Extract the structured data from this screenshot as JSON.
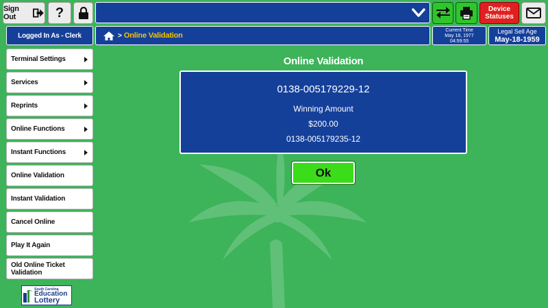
{
  "header": {
    "sign_out_label": "Sign Out",
    "help_label": "?",
    "device_statuses_label": "Device Statuses"
  },
  "status": {
    "logged_in": "Logged In As - Clerk",
    "current_time_label": "Current Time",
    "current_date": "May 18, 1977",
    "current_time": "04:59:55",
    "legal_sell_age_label": "Legal Sell Age",
    "legal_sell_age_date": "May-18-1959"
  },
  "breadcrumb": {
    "separator": ">",
    "current": "Online Validation"
  },
  "sidebar": {
    "items": [
      {
        "label": "Terminal Settings",
        "submenu": true
      },
      {
        "label": "Services",
        "submenu": true
      },
      {
        "label": "Reprints",
        "submenu": true
      },
      {
        "label": "Online Functions",
        "submenu": true
      },
      {
        "label": "Instant Functions",
        "submenu": true
      },
      {
        "label": "Online Validation",
        "submenu": false
      },
      {
        "label": "Instant Validation",
        "submenu": false
      },
      {
        "label": "Cancel Online",
        "submenu": false
      },
      {
        "label": "Play It Again",
        "submenu": false
      },
      {
        "label": "Old Online Ticket Validation",
        "submenu": false
      }
    ]
  },
  "logo": {
    "line1": "South Carolina",
    "line2": "Education",
    "line3": "Lottery"
  },
  "main": {
    "title": "Online Validation",
    "ticket_number": "0138-005179229-12",
    "winning_amount_label": "Winning Amount",
    "winning_amount": "$200.00",
    "new_ticket_number": "0138-005179235-12",
    "ok_label": "Ok"
  },
  "colors": {
    "background": "#3db35a",
    "navy": "#15409a",
    "accent_green": "#3bdc19",
    "alert_red": "#e02020",
    "breadcrumb_text": "#f5c400"
  },
  "icons": [
    "sign-out-icon",
    "lock-icon",
    "chevron-down-icon",
    "swap-icon",
    "printer-icon",
    "mail-icon",
    "home-icon",
    "palm-tree-icon"
  ]
}
